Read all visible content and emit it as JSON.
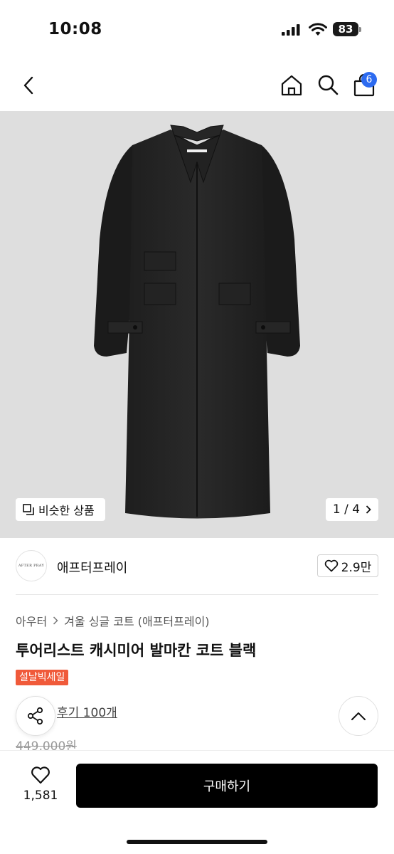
{
  "status": {
    "time": "10:08",
    "battery": "83"
  },
  "nav": {
    "cart_count": "6"
  },
  "gallery": {
    "similar_label": "비슷한 상품",
    "page_indicator": "1 / 4"
  },
  "brand": {
    "logo_text": "AFTER PRAY",
    "name": "애프터프레이",
    "likes": "2.9만"
  },
  "product": {
    "breadcrumb": [
      "아우터",
      "겨울 싱글 코트 (애프터프레이)"
    ],
    "title": "투어리스트 캐시미어 발마칸 코트 블랙",
    "sale_badge": "설날빅세일",
    "reviews": "후기 100개",
    "original_price": "449,000원"
  },
  "bottom": {
    "wish_count": "1,581",
    "buy_label": "구매하기"
  },
  "colors": {
    "badge_blue": "#2d6bf0",
    "sale_red": "#f05a3a",
    "buy_black": "#000000"
  }
}
